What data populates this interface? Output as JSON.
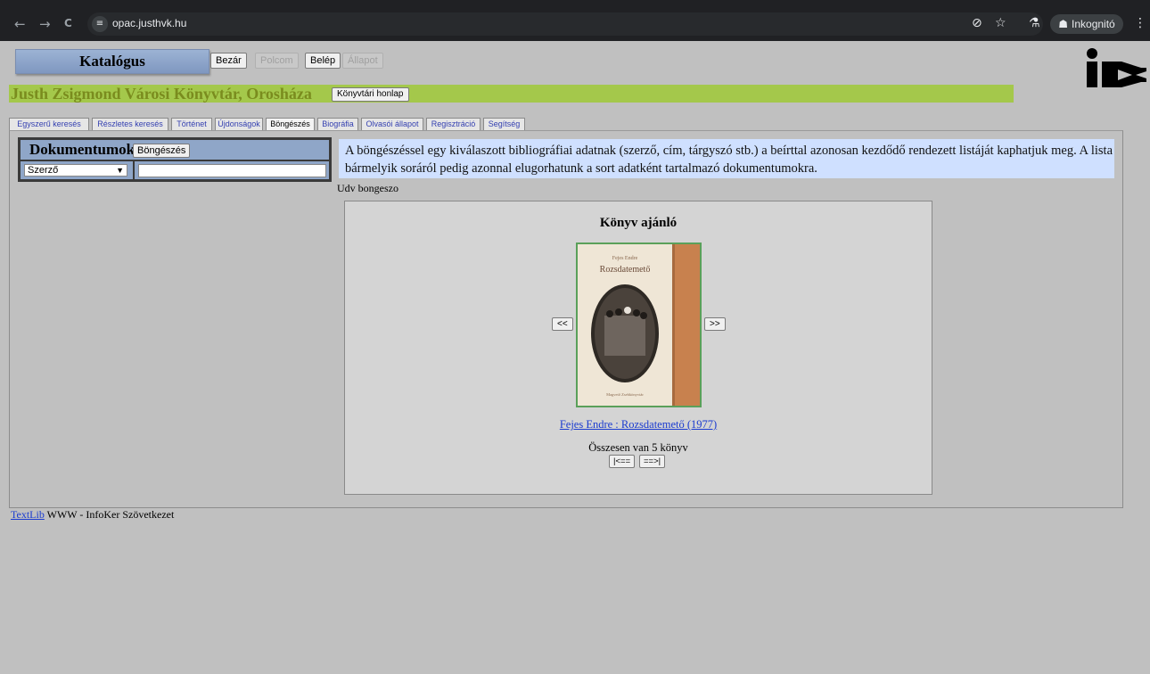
{
  "browser": {
    "url": "opac.justhvk.hu",
    "incognito_label": "Inkognitó",
    "back_icon": "←",
    "forward_icon": "→",
    "reload_icon": "C",
    "site_icon": "≡",
    "eye_off_icon": "⊘",
    "star_icon": "☆",
    "labs_icon": "⚗",
    "incognito_icon": "☗",
    "menu_icon": "⋮"
  },
  "header": {
    "katalogus": "Katalógus",
    "buttons": {
      "bezar": "Bezár",
      "polcom": "Polcom",
      "belep": "Belép",
      "allapot": "Állapot"
    },
    "library_title": "Justh Zsigmond Városi Könyvtár, Orosháza",
    "library_home_button": "Könyvtári honlap"
  },
  "tabs": [
    "Egyszerű keresés",
    "Részletes keresés",
    "Történet",
    "Újdonságok",
    "Böngészés",
    "Biográfia",
    "Olvasói állapot",
    "Regisztráció",
    "Segítség"
  ],
  "active_tab": "Böngészés",
  "search": {
    "title": "Dokumentumok",
    "button": "Böngészés",
    "field_selected": "Szerző",
    "input_value": ""
  },
  "info_text": "A böngészéssel egy kiválaszott bibliográfiai adatnak (szerző, cím, tárgyszó stb.) a beírttal azonosan kezdődő rendezett listáját kaphatjuk meg. A lista bármelyik soráról pedig azonnal elugorhatunk a sort adatként tartalmazó dokumentumokra.",
  "greeting": "Udv bongeszo",
  "recommend": {
    "title": "Könyv ajánló",
    "prev_button": "<<",
    "next_button": ">>",
    "cover_author": "Fejes Endre",
    "cover_title": "Rozsdatemető",
    "cover_publisher": "Magvető Zsebkönyvtár",
    "book_link": "Fejes Endre : Rozsdatemető (1977)",
    "total": "Összesen van 5 könyv",
    "first_button": "|<==",
    "last_button": "==>|"
  },
  "footer": {
    "link": "TextLib",
    "text": " WWW - InfoKer Szövetkezet"
  }
}
